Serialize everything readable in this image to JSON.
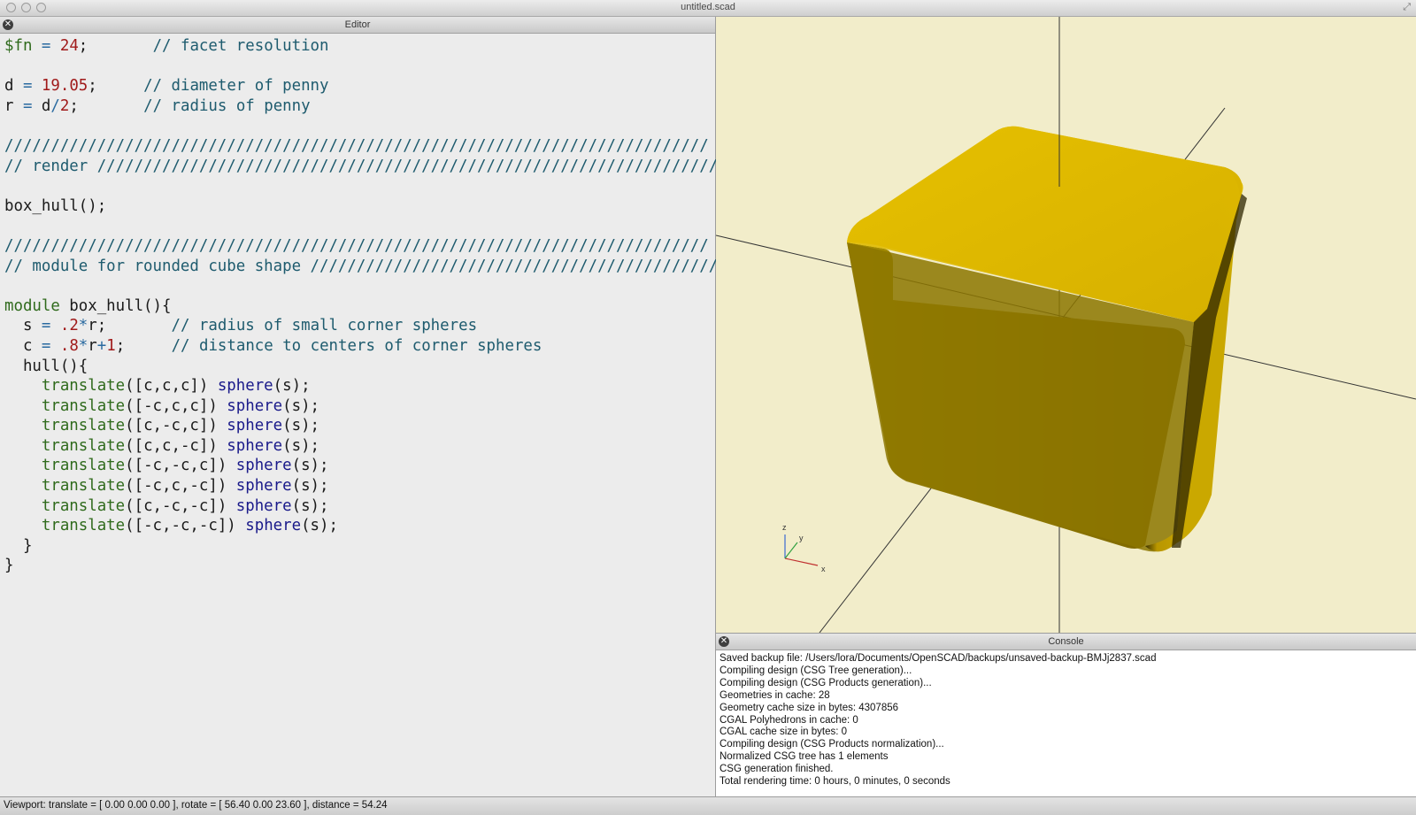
{
  "window": {
    "title": "untitled.scad"
  },
  "editor": {
    "title": "Editor",
    "lines": [
      [
        [
          "kw",
          "$fn"
        ],
        [
          "op",
          " = "
        ],
        [
          "num",
          "24"
        ],
        [
          "",
          "; "
        ],
        [
          "com",
          "      // facet resolution"
        ]
      ],
      [],
      [
        [
          "",
          "d "
        ],
        [
          "op",
          "= "
        ],
        [
          "num",
          "19.05"
        ],
        [
          "",
          "; "
        ],
        [
          "com",
          "    // diameter of penny"
        ]
      ],
      [
        [
          "",
          "r "
        ],
        [
          "op",
          "= "
        ],
        [
          "",
          "d"
        ],
        [
          "op",
          "/"
        ],
        [
          "num",
          "2"
        ],
        [
          "",
          "; "
        ],
        [
          "com",
          "      // radius of penny"
        ]
      ],
      [],
      [
        [
          "com",
          "////////////////////////////////////////////////////////////////////////////"
        ]
      ],
      [
        [
          "com",
          "// render ////////////////////////////////////////////////////////////////////"
        ]
      ],
      [],
      [
        [
          "",
          "box_hull();"
        ]
      ],
      [],
      [
        [
          "com",
          "////////////////////////////////////////////////////////////////////////////"
        ]
      ],
      [
        [
          "com",
          "// module for rounded cube shape //////////////////////////////////////////////"
        ]
      ],
      [],
      [
        [
          "kw",
          "module"
        ],
        [
          "",
          " box_hull(){"
        ]
      ],
      [
        [
          "",
          "  s "
        ],
        [
          "op",
          "= "
        ],
        [
          "num",
          ".2"
        ],
        [
          "op",
          "*"
        ],
        [
          "",
          "r; "
        ],
        [
          "com",
          "      // radius of small corner spheres"
        ]
      ],
      [
        [
          "",
          "  c "
        ],
        [
          "op",
          "= "
        ],
        [
          "num",
          ".8"
        ],
        [
          "op",
          "*"
        ],
        [
          "",
          "r"
        ],
        [
          "op",
          "+"
        ],
        [
          "num",
          "1"
        ],
        [
          "",
          "; "
        ],
        [
          "com",
          "    // distance to centers of corner spheres"
        ]
      ],
      [
        [
          "",
          "  hull(){"
        ]
      ],
      [
        [
          "",
          "    "
        ],
        [
          "kw",
          "translate"
        ],
        [
          "",
          "([c,c,c]) "
        ],
        [
          "fn",
          "sphere"
        ],
        [
          "",
          "(s);"
        ]
      ],
      [
        [
          "",
          "    "
        ],
        [
          "kw",
          "translate"
        ],
        [
          "",
          "([-c,c,c]) "
        ],
        [
          "fn",
          "sphere"
        ],
        [
          "",
          "(s);"
        ]
      ],
      [
        [
          "",
          "    "
        ],
        [
          "kw",
          "translate"
        ],
        [
          "",
          "([c,-c,c]) "
        ],
        [
          "fn",
          "sphere"
        ],
        [
          "",
          "(s);"
        ]
      ],
      [
        [
          "",
          "    "
        ],
        [
          "kw",
          "translate"
        ],
        [
          "",
          "([c,c,-c]) "
        ],
        [
          "fn",
          "sphere"
        ],
        [
          "",
          "(s);"
        ]
      ],
      [
        [
          "",
          "    "
        ],
        [
          "kw",
          "translate"
        ],
        [
          "",
          "([-c,-c,c]) "
        ],
        [
          "fn",
          "sphere"
        ],
        [
          "",
          "(s);"
        ]
      ],
      [
        [
          "",
          "    "
        ],
        [
          "kw",
          "translate"
        ],
        [
          "",
          "([-c,c,-c]) "
        ],
        [
          "fn",
          "sphere"
        ],
        [
          "",
          "(s);"
        ]
      ],
      [
        [
          "",
          "    "
        ],
        [
          "kw",
          "translate"
        ],
        [
          "",
          "([c,-c,-c]) "
        ],
        [
          "fn",
          "sphere"
        ],
        [
          "",
          "(s);"
        ]
      ],
      [
        [
          "",
          "    "
        ],
        [
          "kw",
          "translate"
        ],
        [
          "",
          "([-c,-c,-c]) "
        ],
        [
          "fn",
          "sphere"
        ],
        [
          "",
          "(s);"
        ]
      ],
      [
        [
          "",
          "  }"
        ]
      ],
      [
        [
          "",
          "}"
        ]
      ]
    ]
  },
  "viewport": {
    "background": "#f2edca",
    "cube_color": "#d8b000",
    "axis_labels": {
      "x": "x",
      "y": "y",
      "z": "z"
    }
  },
  "console": {
    "title": "Console",
    "lines": [
      "Saved backup file: /Users/lora/Documents/OpenSCAD/backups/unsaved-backup-BMJj2837.scad",
      "Compiling design (CSG Tree generation)...",
      "Compiling design (CSG Products generation)...",
      "Geometries in cache: 28",
      "Geometry cache size in bytes: 4307856",
      "CGAL Polyhedrons in cache: 0",
      "CGAL cache size in bytes: 0",
      "Compiling design (CSG Products normalization)...",
      "Normalized CSG tree has 1 elements",
      "CSG generation finished.",
      "Total rendering time: 0 hours, 0 minutes, 0 seconds"
    ]
  },
  "status": {
    "text": "Viewport: translate = [ 0.00 0.00 0.00 ], rotate = [ 56.40 0.00 23.60 ], distance = 54.24"
  }
}
